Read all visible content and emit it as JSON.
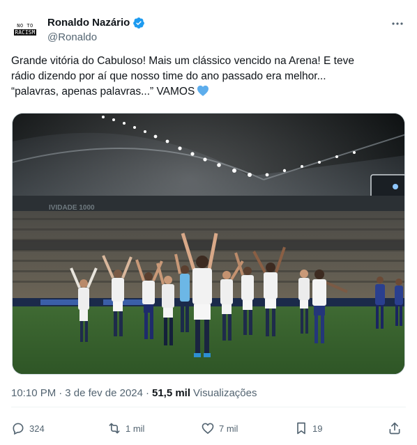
{
  "author": {
    "avatar_line1": "NO TO",
    "avatar_line2": "RACISM",
    "display_name": "Ronaldo Nazário",
    "handle": "@Ronaldo",
    "verified": true
  },
  "tweet": {
    "line1": "Grande vitória do Cabuloso! Mais um clássico vencido na Arena! E teve",
    "line2": "rádio dizendo por aí que nosso time do ano passado era melhor...",
    "line3": "“palavras, apenas palavras...” VAMOS",
    "emoji": "blue-heart"
  },
  "media": {
    "image": "football-team-celebrating-in-stadium",
    "stadium_banner_text": "IVIDADE 1000"
  },
  "meta": {
    "time": "10:10 PM",
    "separator": "·",
    "date": "3 de fev de 2024",
    "separator2": "·",
    "views_count": "51,5 mil",
    "views_label": "Visualizações"
  },
  "actions": {
    "replies": "324",
    "reposts": "1 mil",
    "likes": "7 mil",
    "bookmarks": "19"
  },
  "colors": {
    "text_primary": "#0f1419",
    "text_secondary": "#536471",
    "verified_blue": "#1d9bf0",
    "divider": "#eff3f4"
  }
}
